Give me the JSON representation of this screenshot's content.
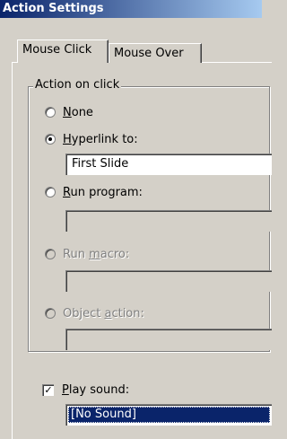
{
  "window": {
    "title": "Action Settings"
  },
  "tabs": [
    {
      "label": "Mouse Click",
      "active": true
    },
    {
      "label": "Mouse Over",
      "active": false
    }
  ],
  "action_group": {
    "legend": "Action on click",
    "options": [
      {
        "prefix": "",
        "mnemonic": "N",
        "suffix": "one",
        "selected": false,
        "enabled": true
      },
      {
        "prefix": "",
        "mnemonic": "H",
        "suffix": "yperlink to:",
        "selected": true,
        "enabled": true
      },
      {
        "prefix": "",
        "mnemonic": "R",
        "suffix": "un program:",
        "selected": false,
        "enabled": true
      },
      {
        "prefix": "Run ",
        "mnemonic": "m",
        "suffix": "acro:",
        "selected": false,
        "enabled": false
      },
      {
        "prefix": "Object ",
        "mnemonic": "a",
        "suffix": "ction:",
        "selected": false,
        "enabled": false
      }
    ],
    "hyperlink_value": "First Slide",
    "run_program_value": "",
    "run_macro_value": "",
    "object_action_value": ""
  },
  "play_sound": {
    "checked": true,
    "label_mnemonic": "P",
    "label_rest": "lay sound:",
    "selected_value": "[No Sound]"
  },
  "colors": {
    "title_bar": "#0a246a",
    "face": "#d4d0c8",
    "selection": "#0a246a"
  }
}
